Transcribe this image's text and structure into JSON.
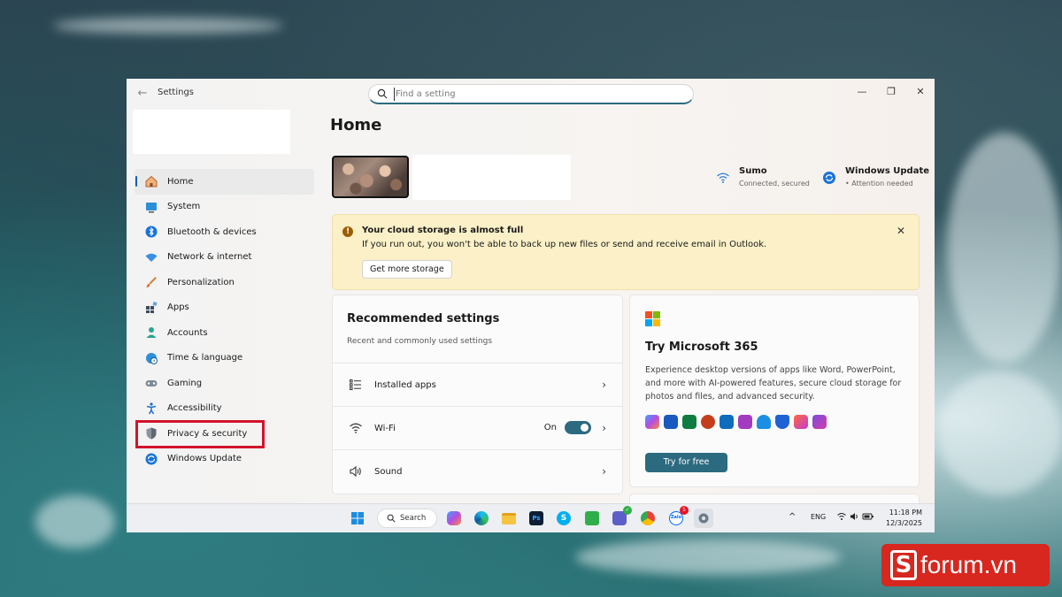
{
  "window": {
    "title": "Settings",
    "search_placeholder": "Find a setting"
  },
  "sidebar": {
    "items": [
      {
        "label": "Home",
        "icon": "home-icon"
      },
      {
        "label": "System",
        "icon": "monitor-icon"
      },
      {
        "label": "Bluetooth & devices",
        "icon": "bluetooth-icon"
      },
      {
        "label": "Network & internet",
        "icon": "wifi-icon"
      },
      {
        "label": "Personalization",
        "icon": "brush-icon"
      },
      {
        "label": "Apps",
        "icon": "apps-icon"
      },
      {
        "label": "Accounts",
        "icon": "person-icon"
      },
      {
        "label": "Time & language",
        "icon": "globe-clock-icon"
      },
      {
        "label": "Gaming",
        "icon": "gamepad-icon"
      },
      {
        "label": "Accessibility",
        "icon": "accessibility-icon"
      },
      {
        "label": "Privacy & security",
        "icon": "shield-icon"
      },
      {
        "label": "Windows Update",
        "icon": "update-icon"
      }
    ],
    "selected": "Home",
    "highlighted": "Privacy & security"
  },
  "main": {
    "title": "Home",
    "wifi": {
      "name": "Sumo",
      "status": "Connected, secured"
    },
    "update": {
      "title": "Windows Update",
      "status": "Attention needed"
    },
    "banner": {
      "title": "Your cloud storage is almost full",
      "text": "If you run out, you won't be able to back up new files or send and receive email in Outlook.",
      "button": "Get more storage"
    },
    "recommended": {
      "title": "Recommended settings",
      "subtitle": "Recent and commonly used settings",
      "rows": [
        {
          "label": "Installed apps",
          "icon": "list-icon"
        },
        {
          "label": "Wi-Fi",
          "icon": "wifi-icon",
          "toggle_label": "On"
        },
        {
          "label": "Sound",
          "icon": "speaker-icon"
        }
      ]
    },
    "microsoft365": {
      "title": "Try Microsoft 365",
      "description": "Experience desktop versions of apps like Word, PowerPoint, and more with AI-powered features, secure cloud storage for photos and files, and advanced security.",
      "button": "Try for free"
    }
  },
  "taskbar": {
    "search_label": "Search",
    "language": "ENG",
    "time": "11:18 PM",
    "date": "12/3/2025",
    "zalo_badge": "5",
    "zalo_label": "Zalo"
  },
  "watermark": {
    "letter": "S",
    "text": "forum.vn"
  },
  "colors": {
    "accent": "#2c6a80",
    "highlight": "#d3132a",
    "banner_bg": "#fbf0c7",
    "watermark": "#d7271f"
  }
}
